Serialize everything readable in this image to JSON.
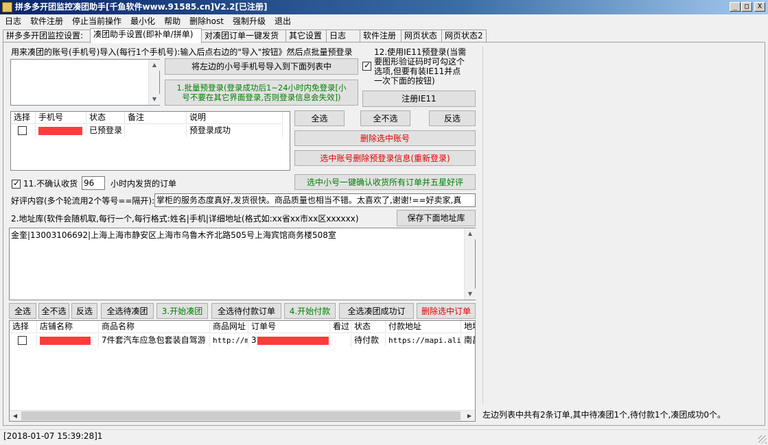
{
  "window": {
    "title": "拼多多开团监控凑团助手[千鱼软件www.91585.cn]V2.2[已注册]",
    "min_glyph": "_",
    "max_glyph": "□",
    "close_glyph": "X"
  },
  "menu": [
    "日志",
    "软件注册",
    "停止当前操作",
    "最小化",
    "帮助",
    "删除host",
    "强制升级",
    "退出"
  ],
  "tabs": [
    "拼多多开团监控设置:",
    "凑团助手设置(即补单/拼单)",
    "对凑团订单一键发货",
    "其它设置",
    "日志",
    "软件注册",
    "网页状态",
    "网页状态2"
  ],
  "account_section": {
    "intro": "用来凑团的账号(手机号)导入(每行1个手机号):输入后点右边的\"导入\"按钮》然后点批量预登录",
    "import_button": "将左边的小号手机号导入到下面列表中",
    "batch_login_button": "1.批量预登录(登录成功后1~24小时内免登录[小\n号不要在其它界面登录,否则登录信息会失效])",
    "ie11_option": "12.使用IE11预登录(当需\n要图形验证码时可勾这个\n选项,但要有装IE11并点\n一次下面的按钮)",
    "ie11_checked": true,
    "register_ie11_button": "注册IE11"
  },
  "account_table": {
    "columns": [
      "选择",
      "手机号",
      "状态",
      "备注",
      "说明"
    ],
    "rows": [
      {
        "checked": false,
        "phone": "",
        "status": "已预登录",
        "note": "",
        "desc": "预登录成功"
      }
    ]
  },
  "account_buttons": {
    "select_all": "全选",
    "select_none": "全不选",
    "invert": "反选",
    "delete_selected": "删除选中账号",
    "delete_prelogin": "选中账号删除预登录信息(重新登录)",
    "confirm_receipt": "选中小号一键确认收货所有订单并五星好评"
  },
  "auto_confirm": {
    "checked": true,
    "label_prefix": "11.不确认收货",
    "hours": "96",
    "label_suffix": "小时内发货的订单"
  },
  "review": {
    "label": "好评内容(多个轮流用2个等号==隔开):",
    "value": "掌柜的服务态度真好,发货很快。商品质量也相当不错。太喜欢了,谢谢!==好卖家,真"
  },
  "address": {
    "label": "2.地址库(软件会随机取,每行一个,每行格式:姓名|手机|详细地址(格式如:xx省xx市xx区xxxxxx)",
    "save_button": "保存下面地址库",
    "content": "金奎|13003106692|上海上海市静安区上海市乌鲁木齐北路505号上海宾馆商务楼508室"
  },
  "order_buttons": {
    "select_all": "全选",
    "select_none": "全不选",
    "invert": "反选",
    "select_pending_group": "全选待凑团",
    "start_group": "3.开始凑团",
    "select_pending_pay": "全选待付款订单",
    "start_pay": "4.开始付款",
    "select_group_success": "全选凑团成功订",
    "delete_orders": "删除选中订单"
  },
  "order_table": {
    "columns": [
      "选择",
      "店铺名称",
      "商品名称",
      "商品网址",
      "订单号",
      "看过",
      "状态",
      "付款地址",
      "地址"
    ],
    "rows": [
      {
        "checked": false,
        "shop": "",
        "product": "7件套汽车应急包套装自驾游",
        "url": "http://m",
        "order_no": "3",
        "viewed": "",
        "status": "待付款",
        "pay_url": "https://mapi.ali",
        "addr": "南昌"
      }
    ]
  },
  "summary": "左边列表中共有2条订单,其中待凑团1个,待付款1个,凑团成功0个。",
  "status_bar": "[2018-01-07 15:39:28]1",
  "colors": {
    "accent_green": "#008000",
    "accent_red": "#e00000",
    "redaction": "#ff3b3b"
  }
}
